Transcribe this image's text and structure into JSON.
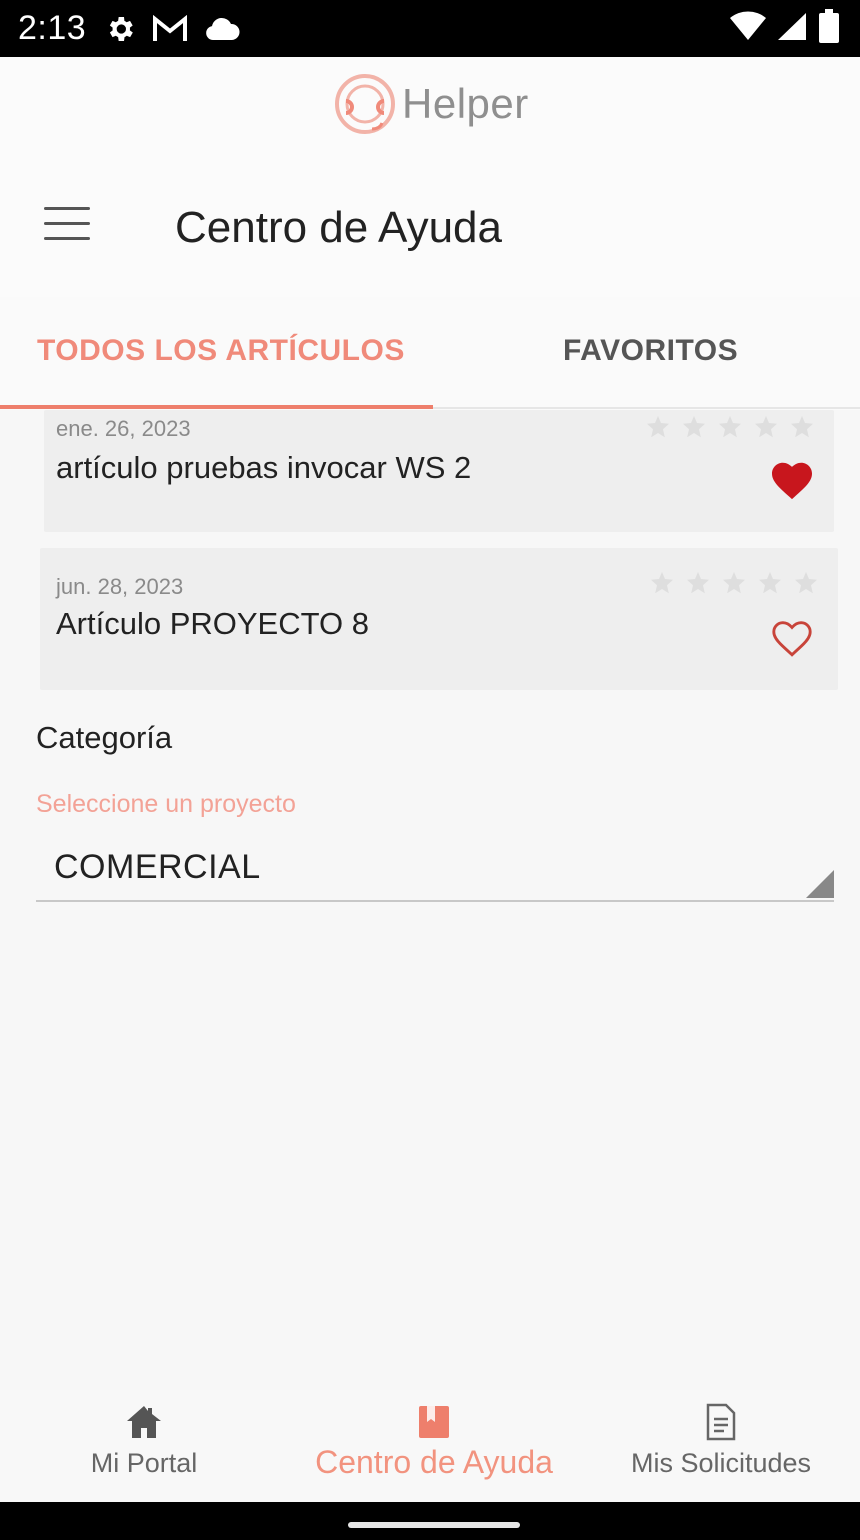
{
  "status_bar": {
    "time": "2:13",
    "icons": [
      "gear-icon",
      "gmail-icon",
      "cloud-icon",
      "wifi-icon",
      "signal-icon",
      "battery-icon"
    ]
  },
  "header": {
    "logo_text": "Helper",
    "title": "Centro de Ayuda"
  },
  "tabs": [
    {
      "label": "TODOS LOS ARTÍCULOS",
      "active": true
    },
    {
      "label": "FAVORITOS",
      "active": false
    }
  ],
  "articles": [
    {
      "date": "ene. 26, 2023",
      "title": "artículo pruebas invocar WS 2",
      "favorite": true,
      "rating": 0
    },
    {
      "date": "jun. 28, 2023",
      "title": "Artículo PROYECTO 8",
      "favorite": false,
      "rating": 0
    }
  ],
  "category": {
    "label": "Categoría",
    "hint": "Seleccione un proyecto",
    "selected": "COMERCIAL"
  },
  "bottom_nav": [
    {
      "label": "Mi Portal",
      "icon": "home-icon",
      "active": false
    },
    {
      "label": "Centro de Ayuda",
      "icon": "book-icon",
      "active": true
    },
    {
      "label": "Mis Solicitudes",
      "icon": "document-icon",
      "active": false
    }
  ],
  "colors": {
    "accent": "#ee7f6c",
    "heart_filled": "#c8161d",
    "card_bg": "#eeeeee"
  }
}
